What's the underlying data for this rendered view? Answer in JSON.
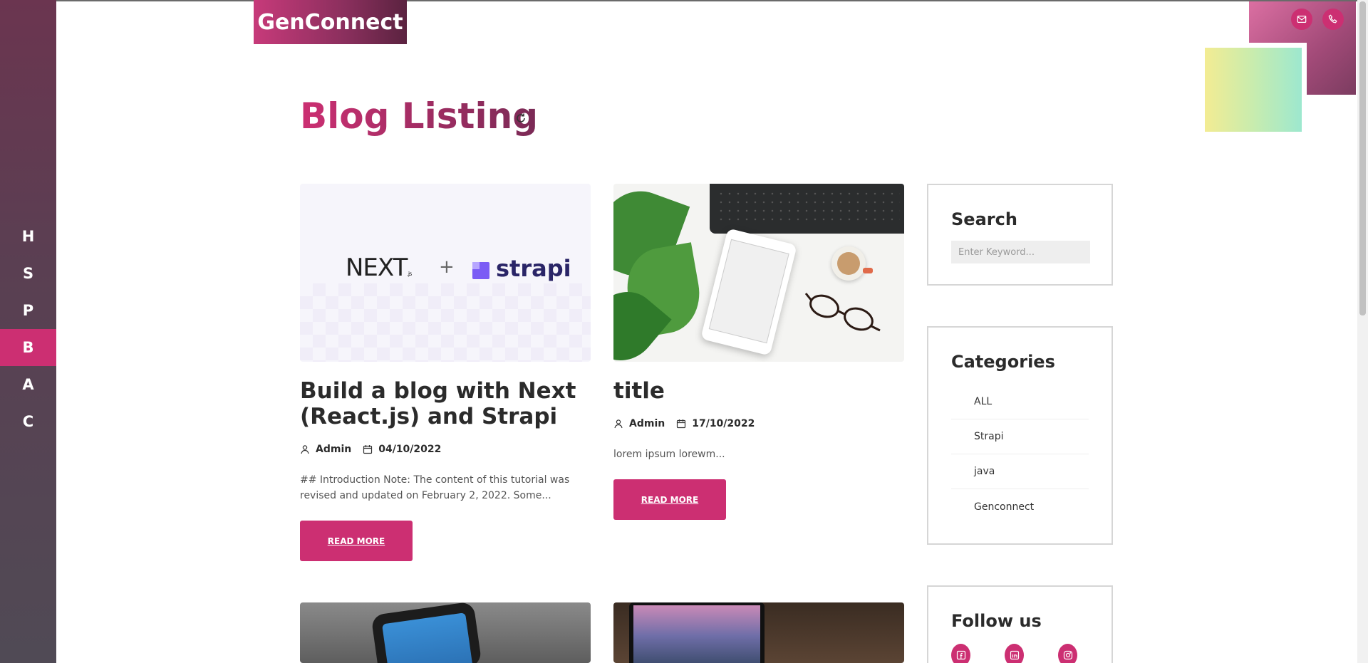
{
  "brand": {
    "name": "GenConnect"
  },
  "nav": {
    "items": [
      {
        "label": "H",
        "active": false
      },
      {
        "label": "S",
        "active": false
      },
      {
        "label": "P",
        "active": false
      },
      {
        "label": "B",
        "active": true
      },
      {
        "label": "A",
        "active": false
      },
      {
        "label": "C",
        "active": false
      }
    ]
  },
  "contact": {
    "icons": [
      "mail-icon",
      "phone-icon"
    ]
  },
  "page": {
    "title": "Blog Listing",
    "refresh_icon": "refresh-icon"
  },
  "posts": [
    {
      "image": "next-strapi-banner",
      "image_text": {
        "next": "NEXT",
        "next_sub": ".js",
        "plus": "+",
        "strapi": "strapi"
      },
      "title": "Build a blog with Next (React.js) and Strapi",
      "author": "Admin",
      "date": "04/10/2022",
      "excerpt": "## Introduction Note: The content of this tutorial was revised and updated on February 2, 2022. Some...",
      "read_more": "READ MORE"
    },
    {
      "image": "desk-online-marketing",
      "title": "title",
      "author": "Admin",
      "date": "17/10/2022",
      "excerpt": "lorem ipsum lorewm...",
      "read_more": "READ MORE"
    },
    {
      "image": "phone-social-networks"
    },
    {
      "image": "laptop-landscape"
    }
  ],
  "sidebar": {
    "search": {
      "title": "Search",
      "placeholder": "Enter Keyword..."
    },
    "categories": {
      "title": "Categories",
      "items": [
        "ALL",
        "Strapi",
        "java",
        "Genconnect"
      ]
    },
    "follow": {
      "title": "Follow us",
      "icons": [
        "facebook-icon",
        "linkedin-icon",
        "instagram-icon"
      ]
    }
  },
  "colors": {
    "accent": "#cc2f72",
    "sidebar_dark": "#5a3f52",
    "title_gradient_end": "#7a2a55"
  }
}
